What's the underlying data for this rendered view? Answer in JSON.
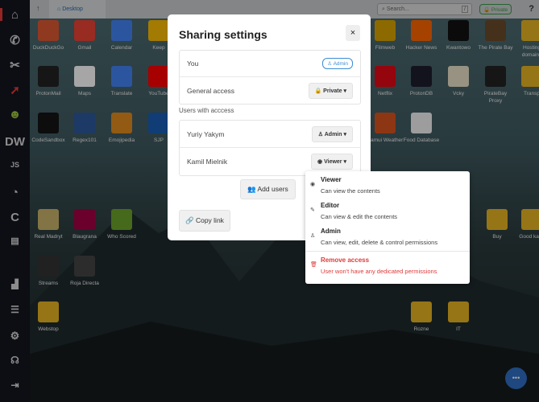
{
  "topbar": {
    "breadcrumb": "Desktop",
    "search_placeholder": "Search...",
    "search_shortcut": "/",
    "privacy": "Private",
    "help": "?"
  },
  "sidebar": {
    "items": [
      "home",
      "phone",
      "tools",
      "cursor",
      "avatar",
      "DW",
      "JS",
      "speed",
      "C",
      "chat",
      "chart",
      "list",
      "settings",
      "support",
      "logout"
    ]
  },
  "desktop": {
    "icons": [
      {
        "label": "DuckDuckGo",
        "color": "#de5833"
      },
      {
        "label": "Gmail",
        "color": "#ea4335"
      },
      {
        "label": "Calendar",
        "color": "#4285f4"
      },
      {
        "label": "Keep",
        "color": "#fbbc04"
      },
      {
        "label": "Filmweb",
        "color": "#d9a400"
      },
      {
        "label": "Hacker News",
        "color": "#ff6600"
      },
      {
        "label": "Kwantowo",
        "color": "#111111"
      },
      {
        "label": "The Pirate Bay",
        "color": "#6b4a2a"
      },
      {
        "label": "Hosting domains",
        "color": "#e6b422"
      },
      {
        "label": "ProtonMail",
        "color": "#222222"
      },
      {
        "label": "Maps",
        "color": "#ffffff"
      },
      {
        "label": "Translate",
        "color": "#4285f4"
      },
      {
        "label": "YouTube",
        "color": "#ff0000"
      },
      {
        "label": "Netflix",
        "color": "#e50914"
      },
      {
        "label": "ProtonDB",
        "color": "#1e1e2e"
      },
      {
        "label": "Vcky",
        "color": "#e8e0c8"
      },
      {
        "label": "PirateBay Proxy",
        "color": "#222222"
      },
      {
        "label": "Transp",
        "color": "#e6b422"
      },
      {
        "label": "CodeSandbox",
        "color": "#151515"
      },
      {
        "label": "Regex101",
        "color": "#2c5a9c"
      },
      {
        "label": "Emojipedia",
        "color": "#e08a1e"
      },
      {
        "label": "SJP",
        "color": "#1a5fb4"
      },
      {
        "label": "Samui Weather",
        "color": "#d9531e"
      },
      {
        "label": "Food Database",
        "color": "#f2f2f2"
      },
      {
        "label": "Real Madryt",
        "color": "#c9b26a"
      },
      {
        "label": "Blaugrana",
        "color": "#a50044"
      },
      {
        "label": "Who Scored",
        "color": "#6aa32a"
      },
      {
        "label": "Buy",
        "color": "#e6b422"
      },
      {
        "label": "Good kaza",
        "color": "#e6b422"
      },
      {
        "label": "Streams",
        "color": "#333333"
      },
      {
        "label": "Roja Directa",
        "color": "#444444"
      },
      {
        "label": "Webstop",
        "color": "#e6b422"
      },
      {
        "label": "Rozne",
        "color": "#e6b422"
      },
      {
        "label": "IT",
        "color": "#e6b422"
      }
    ]
  },
  "modal": {
    "title": "Sharing settings",
    "close": "×",
    "you_label": "You",
    "you_role": "Admin",
    "general_label": "General access",
    "general_value": "Private",
    "users_heading": "Users with acccess",
    "users": [
      {
        "name": "Yuriy Yakym",
        "role": "Admin"
      },
      {
        "name": "Kamil Mielnik",
        "role": "Viewer"
      }
    ],
    "add_users": "Add users",
    "copy_link": "Copy link"
  },
  "role_menu": [
    {
      "title": "Viewer",
      "desc": "Can view the contents"
    },
    {
      "title": "Editor",
      "desc": "Can view & edit the contents"
    },
    {
      "title": "Admin",
      "desc": "Can view, edit, delete & control permissions"
    },
    {
      "title": "Remove access",
      "desc": "User won't have any dedicated permissions"
    }
  ],
  "fab": "•••"
}
